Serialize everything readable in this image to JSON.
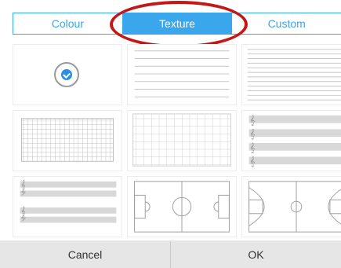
{
  "tabs": [
    {
      "label": "Colour",
      "active": false
    },
    {
      "label": "Texture",
      "active": true
    },
    {
      "label": "Custom",
      "active": false
    }
  ],
  "textures": [
    {
      "name": "plain",
      "selected": true,
      "icon": "check-circle-icon"
    },
    {
      "name": "wide-ruled-lines",
      "selected": false
    },
    {
      "name": "narrow-ruled-lines",
      "selected": false
    },
    {
      "name": "small-grid",
      "selected": false
    },
    {
      "name": "large-grid",
      "selected": false
    },
    {
      "name": "treble-staff",
      "selected": false
    },
    {
      "name": "grand-staff",
      "selected": false
    },
    {
      "name": "soccer-field",
      "selected": false
    },
    {
      "name": "basketball-court",
      "selected": false
    }
  ],
  "footer": {
    "cancel_label": "Cancel",
    "ok_label": "OK"
  },
  "colors": {
    "accent": "#3aa6ec",
    "highlight_ring": "#c41818",
    "check": "#2d8ee0"
  }
}
